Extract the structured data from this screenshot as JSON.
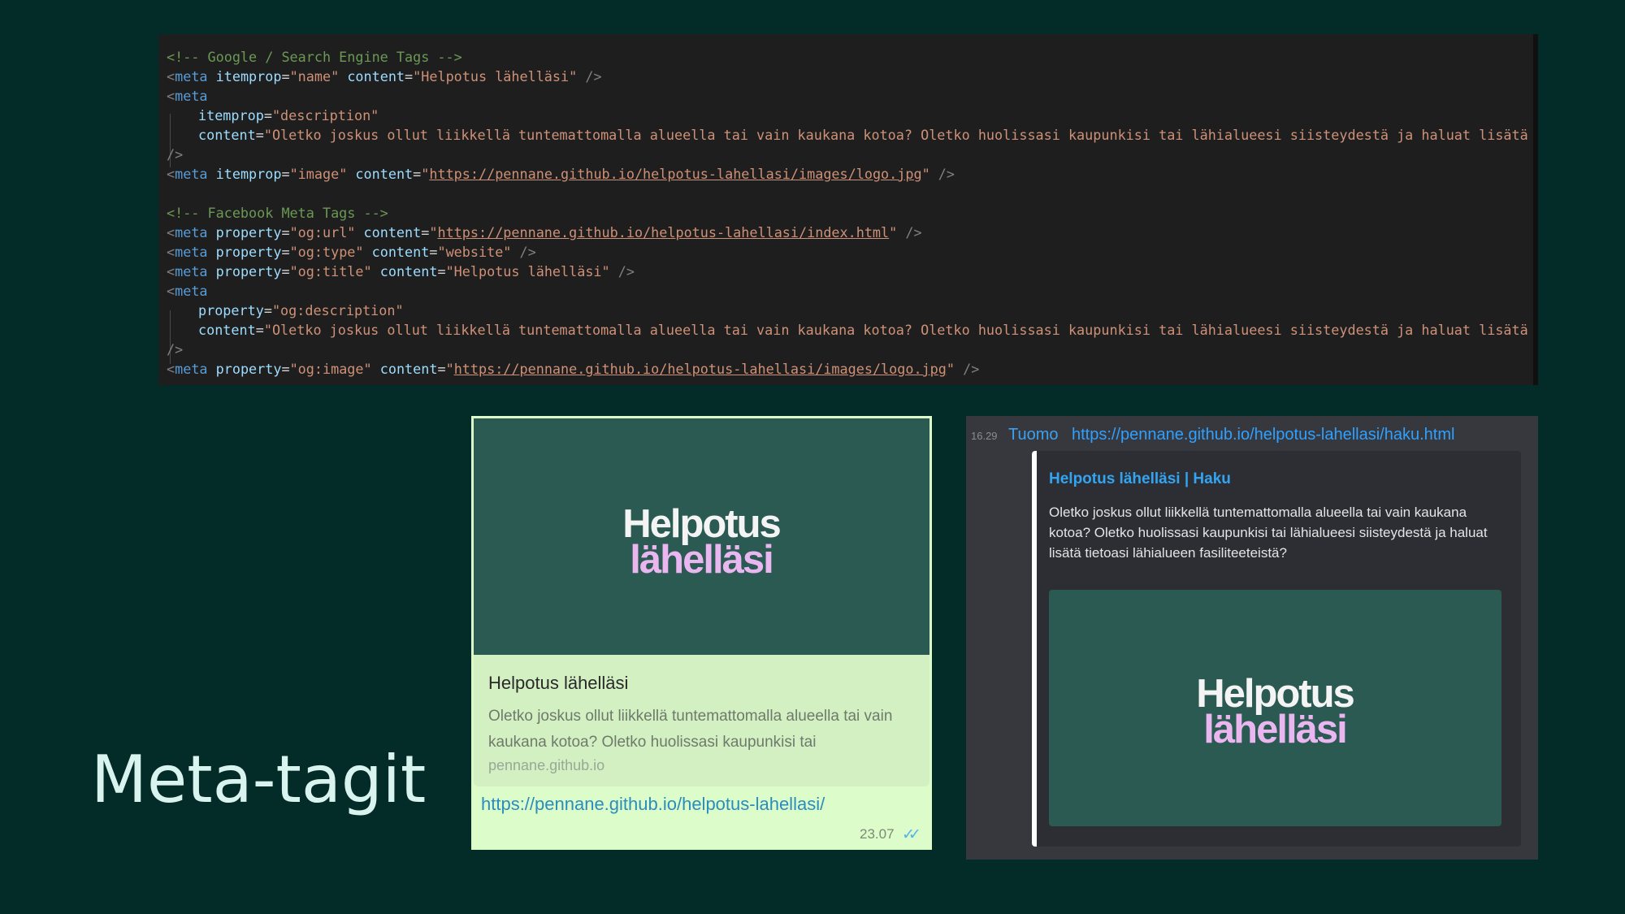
{
  "slide_title": "Meta-tagit",
  "code": {
    "line1": "<!-- Google / Search Engine Tags -->",
    "tag_open": "<",
    "tag_close_self": "/>",
    "meta": "meta",
    "eq": "=",
    "q": "\"",
    "sp": " ",
    "attr_itemprop": "itemprop",
    "attr_content": "content",
    "attr_property": "property",
    "val_name": "\"name\"",
    "val_title": "\"Helpotus lähelläsi\"",
    "val_description": "\"description\"",
    "desc_text": "\"Oletko joskus ollut liikkellä tuntemattomalla alueella tai vain kaukana kotoa? Oletko huolissasi kaupunkisi tai lähialueesi siisteydestä ja haluat lisätä tie",
    "val_image": "\"image\"",
    "url_logo": "https://pennane.github.io/helpotus-lahellasi/images/logo.jpg",
    "line9": "<!-- Facebook Meta Tags -->",
    "val_og_url": "\"og:url\"",
    "url_index": "https://pennane.github.io/helpotus-lahellasi/index.html",
    "val_og_type": "\"og:type\"",
    "val_website": "\"website\"",
    "val_og_title": "\"og:title\"",
    "val_og_description": "\"og:description\"",
    "val_og_image": "\"og:image\""
  },
  "whatsapp": {
    "logo_line1": "Helpotus",
    "logo_line2": "lähelläsi",
    "title": "Helpotus lähelläsi",
    "description": "Oletko joskus ollut liikkellä tuntemattomalla alueella tai vain kaukana kotoa? Oletko huolissasi kaupunkisi tai",
    "domain": "pennane.github.io",
    "url": "https://pennane.github.io/helpotus-lahellasi/",
    "time": "23.07",
    "status_icon": "double-check-icon"
  },
  "discord": {
    "time": "16.29",
    "author": "Tuomo",
    "link": "https://pennane.github.io/helpotus-lahellasi/haku.html",
    "embed_title": "Helpotus lähelläsi | Haku",
    "embed_description": "Oletko joskus ollut liikkellä tuntemattomalla alueella tai vain kaukana kotoa? Oletko huolissasi kaupunkisi tai lähialueesi siisteydestä ja haluat lisätä tietoasi lähialueen fasiliteeteistä?",
    "logo_line1": "Helpotus",
    "logo_line2": "lähelläsi"
  },
  "colors": {
    "background": "#032b28",
    "logo_bg": "#2a5a52",
    "logo_pink": "#e9b6f0",
    "whatsapp_bubble": "#dcfcc9",
    "discord_bg": "#36383e",
    "link_blue": "#32a4f2"
  }
}
